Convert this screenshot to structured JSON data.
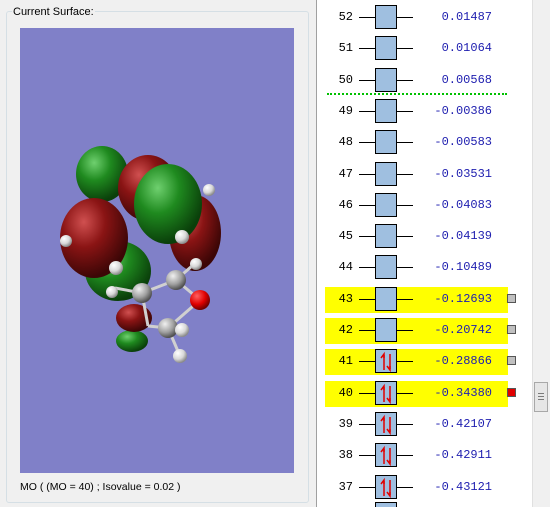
{
  "surface": {
    "group_label": "Current Surface:",
    "status": "MO ( (MO = 40) ; Isovalue = 0.02 )"
  },
  "colors": {
    "viewport_bg": "#8080c8",
    "highlight": "#ffff00",
    "energy_text": "#2020b0",
    "homo_lumo_line": "#00c000",
    "selected_marker": "#e00000",
    "orbital_box": "#9fbfe0",
    "electron_arrows": "#e00000"
  },
  "orbitals": [
    {
      "num": "52",
      "energy": "0.01487",
      "occupied": false,
      "highlighted": false,
      "marker": "none"
    },
    {
      "num": "51",
      "energy": "0.01064",
      "occupied": false,
      "highlighted": false,
      "marker": "none"
    },
    {
      "num": "50",
      "energy": "0.00568",
      "occupied": false,
      "highlighted": false,
      "marker": "none"
    },
    {
      "num": "49",
      "energy": "-0.00386",
      "occupied": false,
      "highlighted": false,
      "marker": "none"
    },
    {
      "num": "48",
      "energy": "-0.00583",
      "occupied": false,
      "highlighted": false,
      "marker": "none"
    },
    {
      "num": "47",
      "energy": "-0.03531",
      "occupied": false,
      "highlighted": false,
      "marker": "none"
    },
    {
      "num": "46",
      "energy": "-0.04083",
      "occupied": false,
      "highlighted": false,
      "marker": "none"
    },
    {
      "num": "45",
      "energy": "-0.04139",
      "occupied": false,
      "highlighted": false,
      "marker": "none"
    },
    {
      "num": "44",
      "energy": "-0.10489",
      "occupied": false,
      "highlighted": false,
      "marker": "none"
    },
    {
      "num": "43",
      "energy": "-0.12693",
      "occupied": false,
      "highlighted": true,
      "marker": "gray"
    },
    {
      "num": "42",
      "energy": "-0.20742",
      "occupied": false,
      "highlighted": true,
      "marker": "gray"
    },
    {
      "num": "41",
      "energy": "-0.28866",
      "occupied": true,
      "highlighted": true,
      "marker": "gray"
    },
    {
      "num": "40",
      "energy": "-0.34380",
      "occupied": true,
      "highlighted": true,
      "marker": "red"
    },
    {
      "num": "39",
      "energy": "-0.42107",
      "occupied": true,
      "highlighted": false,
      "marker": "none"
    },
    {
      "num": "38",
      "energy": "-0.42911",
      "occupied": true,
      "highlighted": false,
      "marker": "none"
    },
    {
      "num": "37",
      "energy": "-0.43121",
      "occupied": true,
      "highlighted": false,
      "marker": "none"
    }
  ]
}
